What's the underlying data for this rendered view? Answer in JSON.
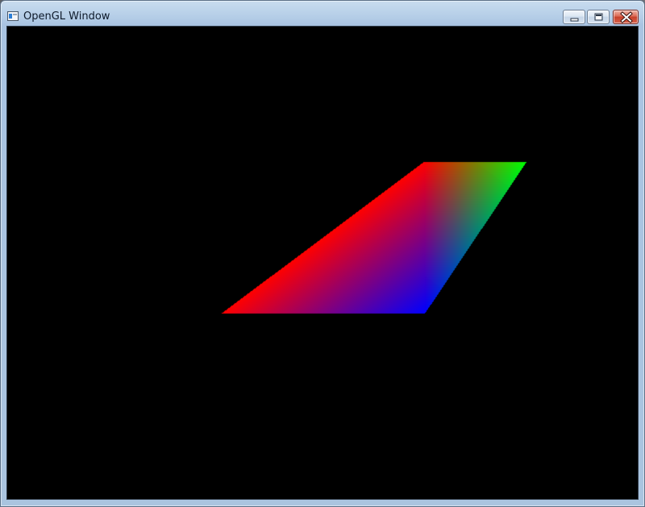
{
  "window": {
    "title": "OpenGL Window",
    "controls": {
      "minimize": "minimize",
      "maximize": "maximize",
      "close": "close"
    }
  },
  "scene": {
    "background": "#000000",
    "shape": "parallelogram",
    "vertex_colors": {
      "top_left": "#ff0000",
      "top_right": "#00ff00",
      "bottom_right": "#0000ff",
      "bottom_left": "#ff0000"
    }
  }
}
